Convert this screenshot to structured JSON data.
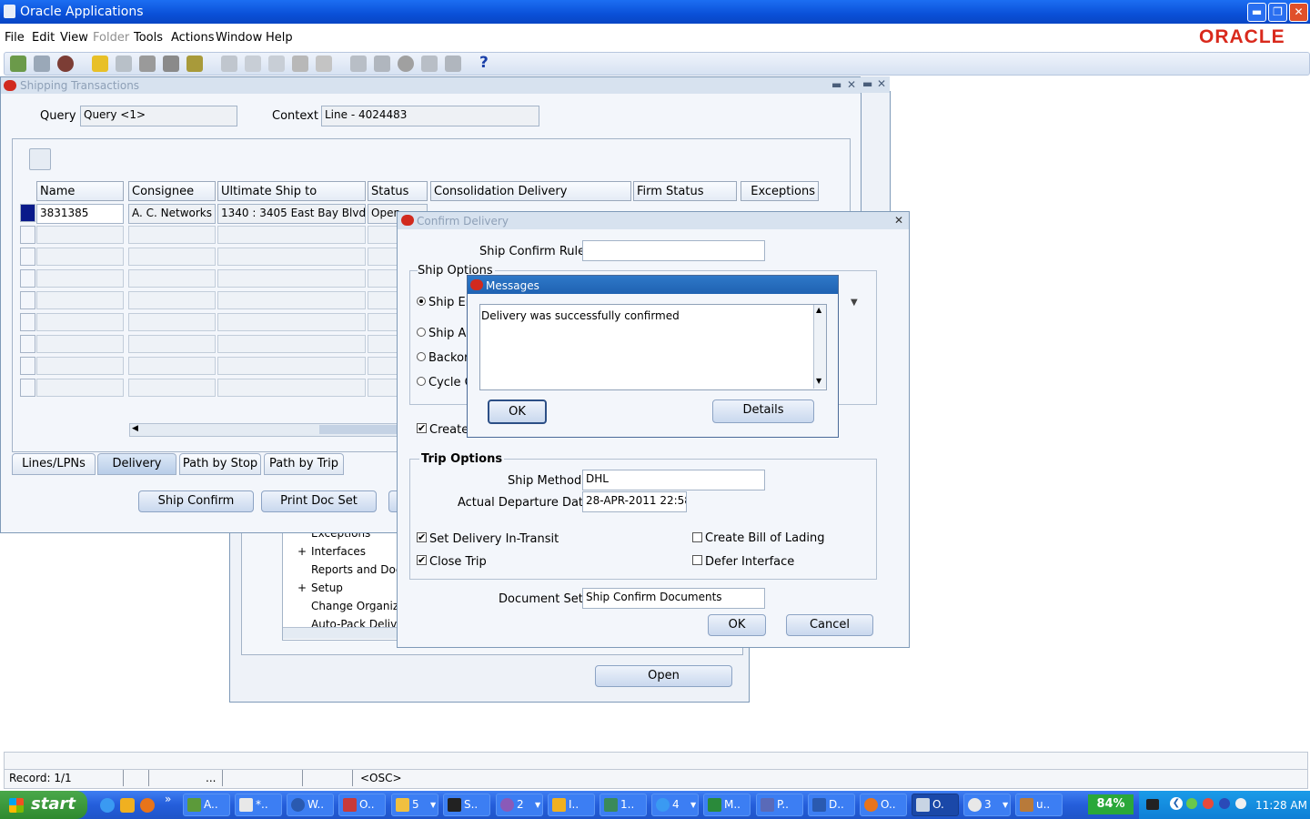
{
  "app": {
    "title": "Oracle Applications",
    "brand": "ORACLE"
  },
  "menu": [
    "File",
    "Edit",
    "View",
    "Folder",
    "Tools",
    "Actions",
    "Window",
    "Help"
  ],
  "shipping": {
    "title": "Shipping Transactions",
    "query_label": "Query",
    "query_value": "Query <1>",
    "context_label": "Context",
    "context_value": "Line - 4024483",
    "columns": [
      "Name",
      "Consignee",
      "Ultimate Ship to",
      "Status",
      "Consolidation Delivery",
      "Firm Status",
      "Exceptions"
    ],
    "row1": {
      "name": "3831385",
      "consignee": "A. C. Networks",
      "ship_to": "1340 : 3405 East Bay Blvd.",
      "status": "Open"
    },
    "tabs": [
      "Lines/LPNs",
      "Delivery",
      "Path by Stop",
      "Path by Trip"
    ],
    "ship_confirm": "Ship Confirm",
    "print_doc_set": "Print Doc Set"
  },
  "navigator": {
    "items": [
      "Exceptions",
      "Interfaces",
      "Reports and Doc",
      "Setup",
      "Change Organiz",
      "Auto-Pack Deliv"
    ],
    "open_button": "Open"
  },
  "confirm": {
    "title": "Confirm Delivery",
    "rule_label": "Ship Confirm Rule",
    "rule_value": "",
    "ship_options_label": "Ship Options",
    "opt1": "Ship En",
    "opt2": "Ship Al",
    "opt3": "Backor",
    "opt4": "Cycle C",
    "create_label": "Create",
    "trip_options_label": "Trip Options",
    "ship_method_label": "Ship Method",
    "ship_method_value": "DHL",
    "departure_label": "Actual Departure Date",
    "departure_value": "28-APR-2011 22:58",
    "in_transit_label": "Set Delivery In-Transit",
    "close_trip_label": "Close Trip",
    "bol_label": "Create Bill of Lading",
    "defer_label": "Defer Interface",
    "docset_label": "Document Set",
    "docset_value": "Ship Confirm Documents",
    "ok": "OK",
    "cancel": "Cancel"
  },
  "messages": {
    "title": "Messages",
    "text": "Delivery was successfully confirmed",
    "ok": "OK",
    "details": "Details"
  },
  "status_bar": {
    "record": "Record: 1/1",
    "ellipsis": "...",
    "osc": "<OSC>"
  },
  "taskbar": {
    "start": "start",
    "tasks": [
      "A..",
      "*..",
      "W..",
      "O..",
      "5",
      "S..",
      "2",
      "I..",
      "1..",
      "4",
      "M..",
      "P..",
      "D..",
      "O..",
      "O.",
      "3",
      "u.."
    ],
    "battery": "84%",
    "clock": "11:28 AM"
  }
}
